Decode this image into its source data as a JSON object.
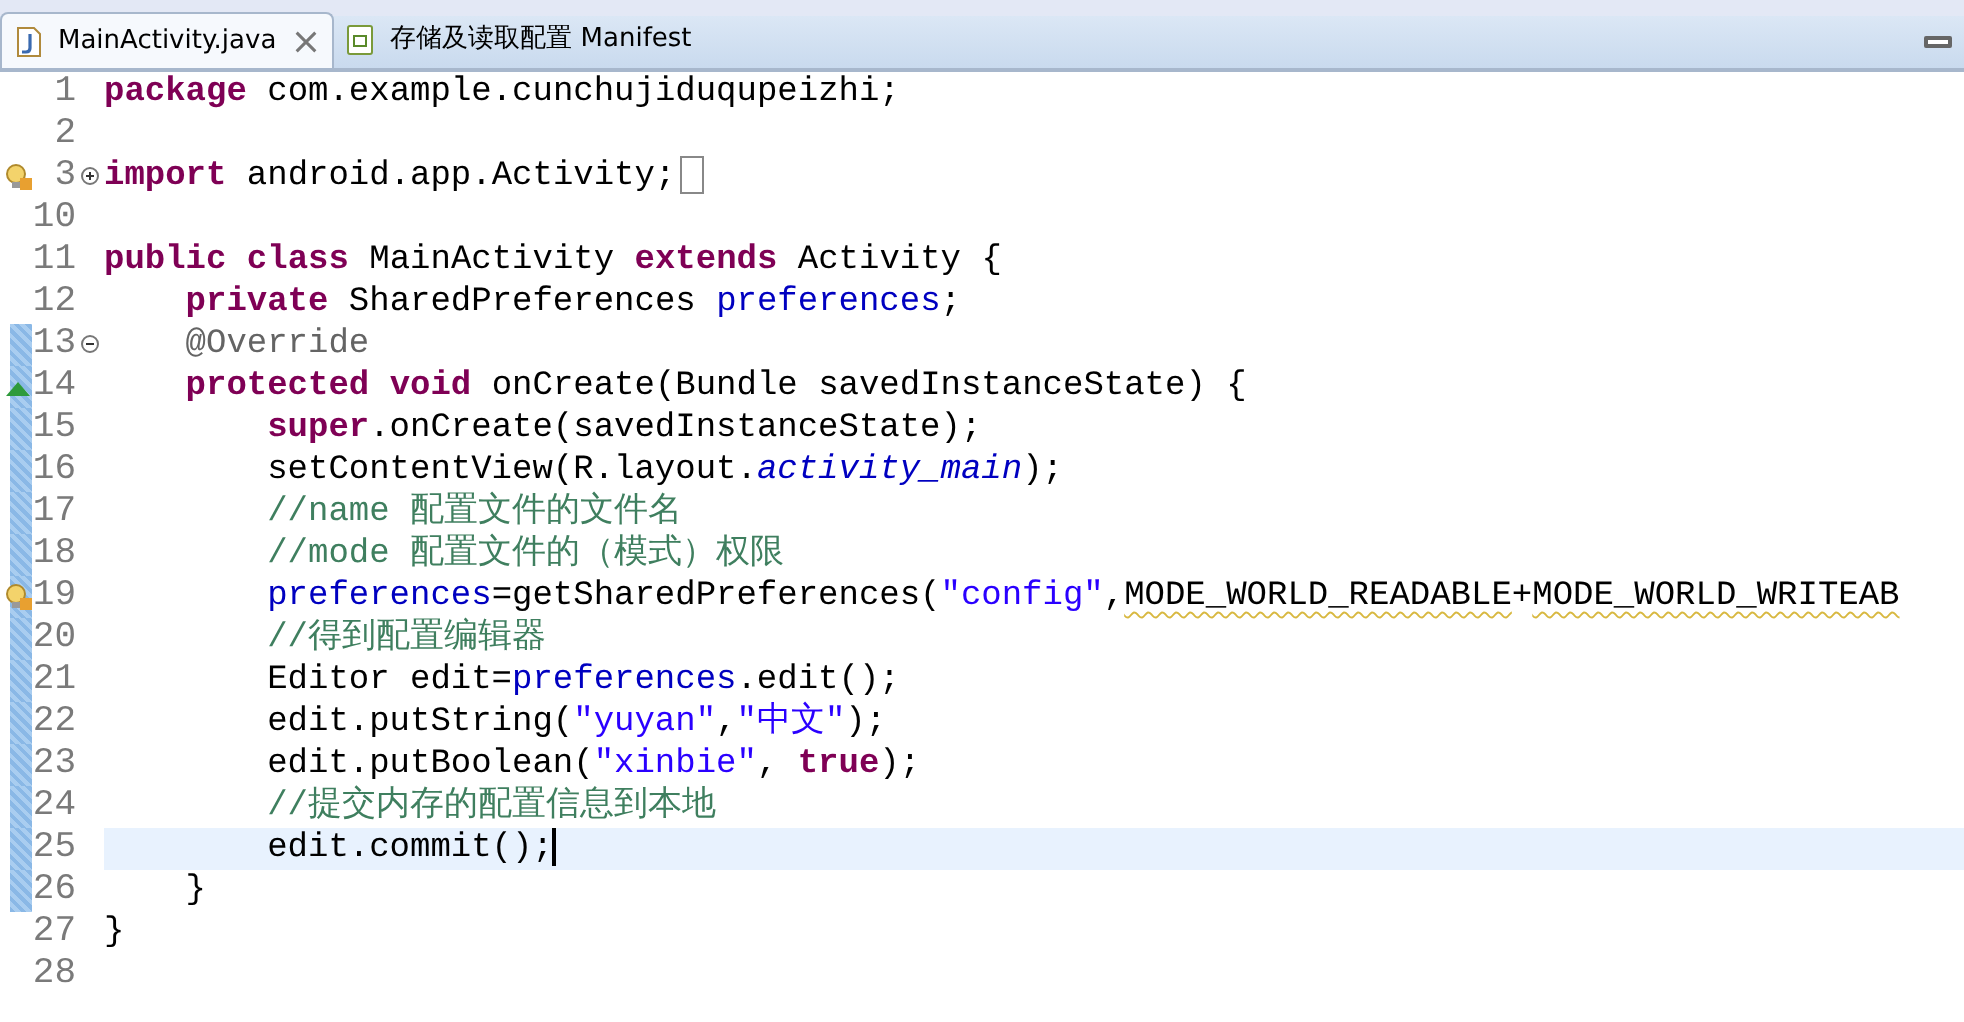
{
  "tabs": [
    {
      "label": "MainActivity.java",
      "selected": true
    },
    {
      "label": "存储及读取配置 Manifest",
      "selected": false
    }
  ],
  "lines": [
    {
      "number": "1",
      "tokens": [
        {
          "text": "package",
          "kind": "keyword"
        },
        {
          "text": " com.example.cunchujiduqupeizhi;",
          "kind": "plain"
        }
      ]
    },
    {
      "number": "2"
    },
    {
      "number": "3",
      "warning": true,
      "folded": true,
      "tokens": [
        {
          "text": "import",
          "kind": "keyword"
        },
        {
          "text": " android.app.Activity;",
          "kind": "plain"
        }
      ]
    },
    {
      "number": "10"
    },
    {
      "number": "11",
      "tokens": [
        {
          "text": "public",
          "kind": "keyword"
        },
        {
          "text": " class",
          "kind": "keyword"
        },
        {
          "text": " MainActivity ",
          "kind": "plain"
        },
        {
          "text": "extends",
          "kind": "keyword"
        },
        {
          "text": " Activity {",
          "kind": "plain"
        }
      ],
      "children": [
        {
          "number": "12",
          "tokens": [
            {
              "text": "private",
              "kind": "keyword"
            },
            {
              "text": " SharedPreferences ",
              "kind": "plain"
            },
            {
              "text": "preferences",
              "kind": "field"
            },
            {
              "text": ";",
              "kind": "plain"
            }
          ]
        },
        {
          "number": "13",
          "folded": false,
          "changed": true,
          "tokens": [
            {
              "text": "@Override",
              "kind": "annotation"
            }
          ]
        },
        {
          "number": "14",
          "override": true,
          "changed": true,
          "tokens": [
            {
              "text": "protected",
              "kind": "keyword"
            },
            {
              "text": " void",
              "kind": "keyword"
            },
            {
              "text": " onCreate(Bundle savedInstanceState) {",
              "kind": "plain"
            }
          ],
          "children": [
            {
              "number": "15",
              "changed": true,
              "tokens": [
                {
                  "text": "super",
                  "kind": "keyword"
                },
                {
                  "text": ".onCreate(savedInstanceState);",
                  "kind": "plain"
                }
              ]
            },
            {
              "number": "16",
              "changed": true,
              "tokens": [
                {
                  "text": "setContentView(R.layout.",
                  "kind": "plain"
                },
                {
                  "text": "activity_main",
                  "kind": "static"
                },
                {
                  "text": ");",
                  "kind": "plain"
                }
              ]
            },
            {
              "number": "17",
              "changed": true,
              "tokens": [
                {
                  "text": "//name 配置文件的文件名",
                  "kind": "comment"
                }
              ]
            },
            {
              "number": "18",
              "changed": true,
              "tokens": [
                {
                  "text": "//mode 配置文件的（模式）权限",
                  "kind": "comment"
                }
              ]
            },
            {
              "number": "19",
              "warning": true,
              "changed": true,
              "tokens": [
                {
                  "text": "preferences",
                  "kind": "field"
                },
                {
                  "text": "=getSharedPreferences(",
                  "kind": "plain"
                },
                {
                  "text": "\"config\"",
                  "kind": "string"
                },
                {
                  "text": ",",
                  "kind": "plain"
                },
                {
                  "text": "MODE_WORLD_READABLE",
                  "kind": "deprecated"
                },
                {
                  "text": "+",
                  "kind": "plain"
                },
                {
                  "text": "MODE_WORLD_WRITEAB",
                  "kind": "deprecated"
                }
              ]
            },
            {
              "number": "20",
              "changed": true,
              "tokens": [
                {
                  "text": "//得到配置编辑器",
                  "kind": "comment"
                }
              ]
            },
            {
              "number": "21",
              "changed": true,
              "tokens": [
                {
                  "text": "Editor edit=",
                  "kind": "plain"
                },
                {
                  "text": "preferences",
                  "kind": "field"
                },
                {
                  "text": ".edit();",
                  "kind": "plain"
                }
              ]
            },
            {
              "number": "22",
              "changed": true,
              "tokens": [
                {
                  "text": "edit.putString(",
                  "kind": "plain"
                },
                {
                  "text": "\"yuyan\"",
                  "kind": "string"
                },
                {
                  "text": ",",
                  "kind": "plain"
                },
                {
                  "text": "\"中文\"",
                  "kind": "string"
                },
                {
                  "text": ");",
                  "kind": "plain"
                }
              ]
            },
            {
              "number": "23",
              "changed": true,
              "tokens": [
                {
                  "text": "edit.putBoolean(",
                  "kind": "plain"
                },
                {
                  "text": "\"xinbie\"",
                  "kind": "string"
                },
                {
                  "text": ", ",
                  "kind": "plain"
                },
                {
                  "text": "true",
                  "kind": "keyword"
                },
                {
                  "text": ");",
                  "kind": "plain"
                }
              ]
            },
            {
              "number": "24",
              "changed": true,
              "tokens": [
                {
                  "text": "//提交内存的配置信息到本地",
                  "kind": "comment"
                }
              ]
            },
            {
              "number": "25",
              "changed": true,
              "current": true,
              "tokens": [
                {
                  "text": "edit.commit();",
                  "kind": "plain"
                }
              ]
            }
          ]
        },
        {
          "number": "26",
          "changed": true,
          "tokens": [
            {
              "text": "}",
              "kind": "plain"
            }
          ]
        }
      ]
    },
    {
      "number": "27",
      "tokens": [
        {
          "text": "}",
          "kind": "plain"
        }
      ]
    },
    {
      "number": "28"
    }
  ]
}
